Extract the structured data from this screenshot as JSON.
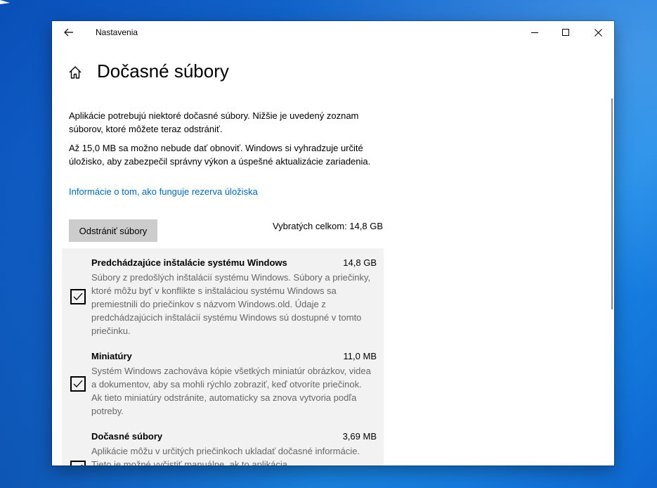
{
  "window": {
    "title": "Nastavenia"
  },
  "page": {
    "title": "Dočasné súbory",
    "description_1": "Aplikácie potrebujú niektoré dočasné súbory. Nižšie je uvedený zoznam súborov, ktoré môžete teraz odstrániť.",
    "description_2": "Až 15,0 MB sa možno nebude dať obnoviť. Windows si vyhradzuje určité úložisko, aby zabezpečil správny výkon a úspešné aktualizácie zariadenia.",
    "info_link": "Informácie o tom, ako funguje rezerva úložiska",
    "delete_button": "Odstrániť súbory",
    "total_selected": "Vybratých celkom: 14,8 GB"
  },
  "items": [
    {
      "title": "Predchádzajúce inštalácie systému Windows",
      "size": "14,8 GB",
      "checked": true,
      "description": "Súbory z predošlých inštalácií systému Windows. Súbory a priečinky, ktoré môžu byť v konflikte s inštaláciou systému Windows sa premiestnili do priečinkov s názvom Windows.old. Údaje z predchádzajúcich inštalácií systému Windows sú dostupné v tomto priečinku."
    },
    {
      "title": "Miniatúry",
      "size": "11,0 MB",
      "checked": true,
      "description": "Systém Windows zachováva kópie všetkých miniatúr obrázkov, videa a dokumentov, aby sa mohli rýchlo zobraziť, keď otvoríte priečinok. Ak tieto miniatúry odstránite, automaticky sa znova vytvoria podľa potreby."
    },
    {
      "title": "Dočasné súbory",
      "size": "3,69 MB",
      "checked": true,
      "description": "Aplikácie môžu v určitých priečinkoch ukladať dočasné informácie. Tieto je možné vyčistiť manuálne, ak to aplikácia"
    }
  ],
  "icons": {
    "back": "arrow-left-icon",
    "minimize": "minimize-icon",
    "maximize": "maximize-icon",
    "close": "close-icon",
    "home": "home-icon",
    "checkbox": "checkmark-icon"
  },
  "colors": {
    "link": "#0067b8",
    "button_bg": "#cccccc",
    "list_bg": "#f2f2f2",
    "desc_text": "#666666"
  }
}
